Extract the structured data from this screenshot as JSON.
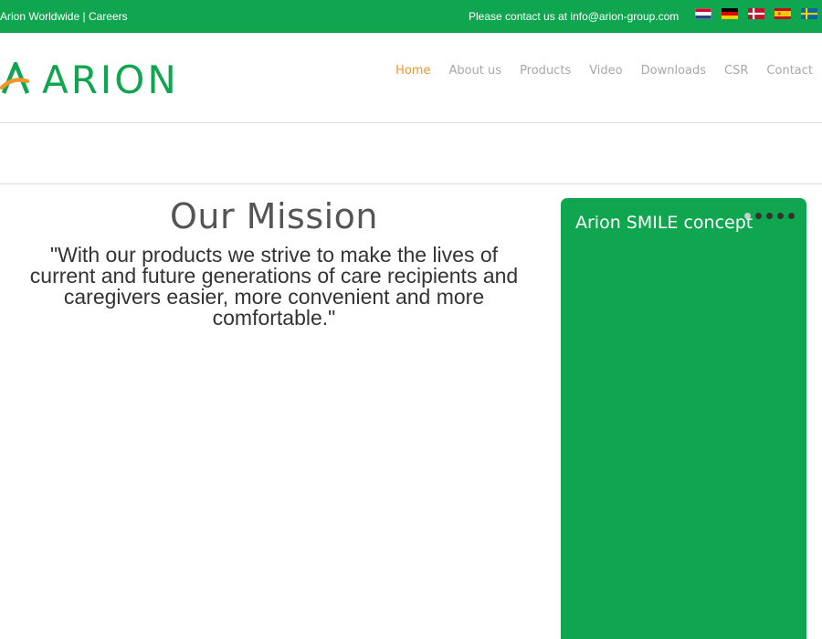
{
  "topbar": {
    "worldwide": "Arion Worldwide",
    "separator": " | ",
    "careers": "Careers",
    "contact_text": "Please contact us at info@arion-group.com",
    "flags": [
      "flag-netherlands",
      "flag-germany",
      "flag-denmark",
      "flag-spain",
      "flag-sweden"
    ]
  },
  "logo": {
    "text": "ARION"
  },
  "nav": {
    "items": [
      {
        "label": "Home",
        "active": true
      },
      {
        "label": "About us"
      },
      {
        "label": "Products"
      },
      {
        "label": "Video"
      },
      {
        "label": "Downloads"
      },
      {
        "label": "CSR"
      },
      {
        "label": "Contact"
      }
    ]
  },
  "mission": {
    "title": "Our Mission",
    "text": "\"With our products we strive to make the lives of current and future generations of care recipients and caregivers easier, more convenient and more comfortable.\""
  },
  "panel": {
    "title": "Arion SMILE concept",
    "slide_count": 5,
    "active_slide": 1
  },
  "colors": {
    "brand_green": "#10a650",
    "accent_orange": "#f0962c",
    "nav_gray": "#a7a7a7",
    "text_dark": "#333333"
  }
}
